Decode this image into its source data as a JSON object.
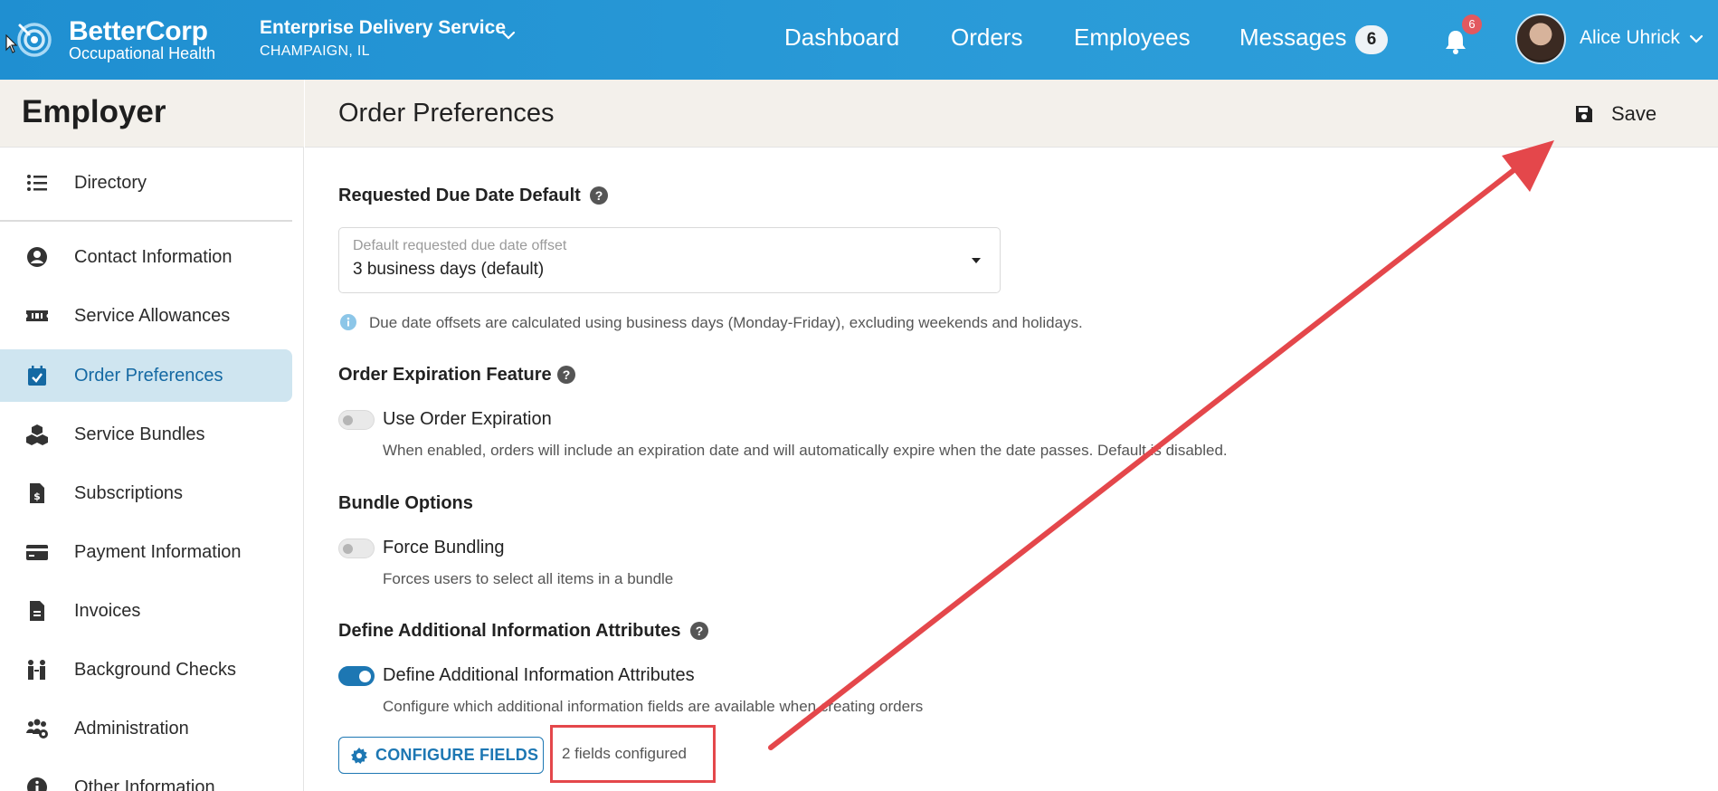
{
  "topbar": {
    "brand_name": "BetterCorp",
    "brand_sub": "Occupational Health",
    "org_name": "Enterprise Delivery Service",
    "org_location": "CHAMPAIGN, IL",
    "nav": [
      "Dashboard",
      "Orders",
      "Employees",
      "Messages"
    ],
    "messages_count": "6",
    "notifications_count": "6",
    "user_name": "Alice Uhrick",
    "colors": {
      "bar": "#2a9bd8",
      "badge_alert": "#e2595f"
    }
  },
  "sidebar": {
    "title": "Employer",
    "items": [
      {
        "label": "Directory",
        "icon": "list-icon"
      },
      {
        "label": "Contact Information",
        "icon": "user-circle-icon"
      },
      {
        "label": "Service Allowances",
        "icon": "ticket-icon"
      },
      {
        "label": "Order Preferences",
        "icon": "calendar-check-icon",
        "active": true
      },
      {
        "label": "Service Bundles",
        "icon": "cubes-icon"
      },
      {
        "label": "Subscriptions",
        "icon": "invoice-dollar-icon"
      },
      {
        "label": "Payment Information",
        "icon": "credit-card-icon"
      },
      {
        "label": "Invoices",
        "icon": "file-icon"
      },
      {
        "label": "Background Checks",
        "icon": "people-arrows-icon"
      },
      {
        "label": "Administration",
        "icon": "users-gear-icon"
      },
      {
        "label": "Other Information",
        "icon": "info-circle-icon"
      }
    ]
  },
  "main": {
    "title": "Order Preferences",
    "save_label": "Save",
    "due_date": {
      "title": "Requested Due Date Default",
      "select_label": "Default requested due date offset",
      "select_value": "3 business days (default)",
      "info": "Due date offsets are calculated using business days (Monday-Friday), excluding weekends and holidays."
    },
    "expiration": {
      "title": "Order Expiration Feature",
      "toggle_label": "Use Order Expiration",
      "toggle_on": false,
      "desc": "When enabled, orders will include an expiration date and will automatically expire when the date passes. Default is disabled."
    },
    "bundle": {
      "title": "Bundle Options",
      "toggle_label": "Force Bundling",
      "toggle_on": false,
      "desc": "Forces users to select all items in a bundle"
    },
    "attributes": {
      "title": "Define Additional Information Attributes",
      "toggle_label": "Define Additional Information Attributes",
      "toggle_on": true,
      "desc": "Configure which additional information fields are available when creating orders",
      "configure_label": "CONFIGURE FIELDS",
      "count_text": "2 fields configured"
    },
    "annotation_color": "#e4474b"
  }
}
